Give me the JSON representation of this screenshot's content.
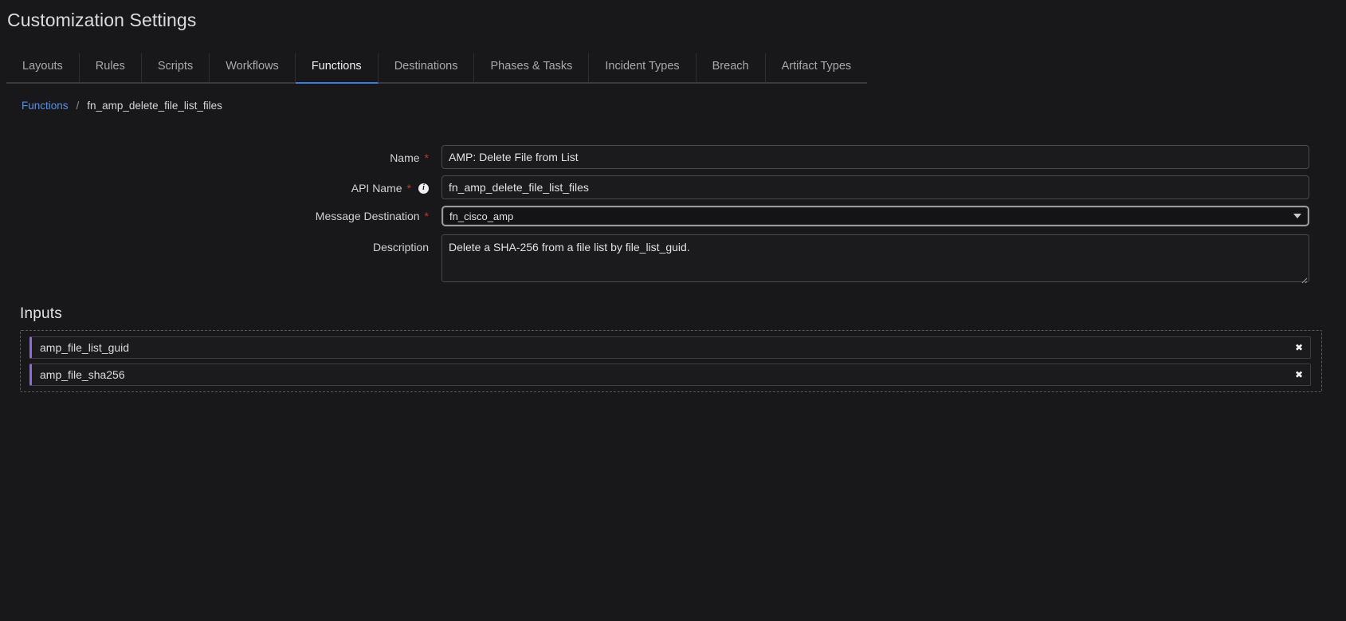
{
  "page": {
    "title": "Customization Settings"
  },
  "tabs": [
    {
      "label": "Layouts",
      "active": false
    },
    {
      "label": "Rules",
      "active": false
    },
    {
      "label": "Scripts",
      "active": false
    },
    {
      "label": "Workflows",
      "active": false
    },
    {
      "label": "Functions",
      "active": true
    },
    {
      "label": "Destinations",
      "active": false
    },
    {
      "label": "Phases & Tasks",
      "active": false
    },
    {
      "label": "Incident Types",
      "active": false
    },
    {
      "label": "Breach",
      "active": false
    },
    {
      "label": "Artifact Types",
      "active": false
    }
  ],
  "breadcrumb": {
    "parent": "Functions",
    "separator": "/",
    "current": "fn_amp_delete_file_list_files"
  },
  "form": {
    "name": {
      "label": "Name",
      "required_marker": "*",
      "value": "AMP: Delete File from List"
    },
    "api_name": {
      "label": "API Name",
      "required_marker": "*",
      "info_icon": "info-icon",
      "info_glyph": "i",
      "value": "fn_amp_delete_file_list_files"
    },
    "message_destination": {
      "label": "Message Destination",
      "required_marker": "*",
      "value": "fn_cisco_amp",
      "arrow_icon": "chevron-down-icon"
    },
    "description": {
      "label": "Description",
      "value": "Delete a SHA-256 from a file list by file_list_guid."
    }
  },
  "inputs": {
    "heading": "Inputs",
    "items": [
      {
        "label": "amp_file_list_guid",
        "remove_glyph": "✖"
      },
      {
        "label": "amp_file_sha256",
        "remove_glyph": "✖"
      }
    ]
  },
  "colors": {
    "page_bg": "#18181a",
    "accent_tab": "#3b7ddd",
    "link": "#5a8ee0",
    "required": "#c0392b",
    "chip_accent": "#8a6ddb",
    "text_primary": "#e6e6e6",
    "text_muted": "#a9a9ad"
  }
}
